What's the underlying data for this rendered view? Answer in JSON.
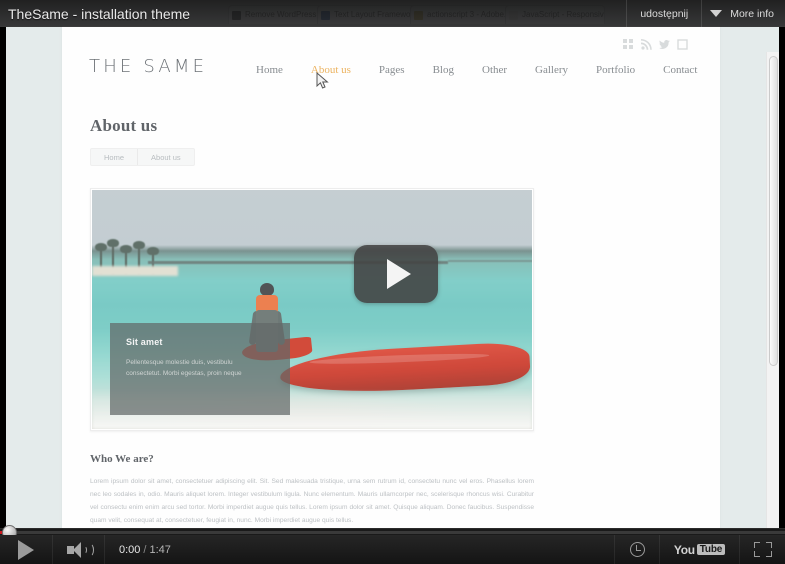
{
  "video_player": {
    "title": "TheSame - installation theme",
    "share_label": "udostępnij",
    "more_info_label": "More info",
    "current_time": "0:00",
    "time_separator": "/",
    "total_time": "1:47",
    "logo_word": "You",
    "logo_box": "Tube",
    "progress_percent": 0,
    "accent_color": "#cc181e"
  },
  "browser": {
    "tabs": [
      {
        "label": "Remove WordPress De...",
        "favicon_color": "#3b4046"
      },
      {
        "label": "Text Layout Framework...",
        "favicon_color": "#2f5fa8"
      },
      {
        "label": "actionscript 3 - Adobe...",
        "favicon_color": "#b8a24a"
      },
      {
        "label": "JavaScript - Responsiv...",
        "favicon_color": "#d6d6d6"
      }
    ]
  },
  "site": {
    "brand": "THE SAME",
    "nav": [
      {
        "label": "Home",
        "active": false
      },
      {
        "label": "About us",
        "active": true
      },
      {
        "label": "Pages",
        "active": false
      },
      {
        "label": "Blog",
        "active": false
      },
      {
        "label": "Other",
        "active": false
      },
      {
        "label": "Gallery",
        "active": false
      },
      {
        "label": "Portfolio",
        "active": false
      },
      {
        "label": "Contact",
        "active": false
      }
    ],
    "social_icons": [
      "grid-icon",
      "rss-icon",
      "twitter-icon",
      "square-icon"
    ],
    "accent_color": "#e8a33d"
  },
  "page": {
    "title": "About us",
    "breadcrumb": [
      {
        "label": "Home"
      },
      {
        "label": "About us"
      }
    ],
    "media": {
      "caption_title": "Sit amet",
      "caption_line1": "Pellentesque molestie duis, vestibulu",
      "caption_line2": "consectetut. Morbi egestas, proin neque",
      "play_button": "play-icon"
    },
    "section": {
      "heading": "Who We are?",
      "body": "Lorem ipsum dolor sit amet, consectetuer adipiscing elit. Sit. Sed malesuada tristique, urna sem rutrum id, consectetu nunc vel eros. Phasellus lorem nec leo sodales in, odio. Mauris aliquet lorem. Integer vestibulum ligula. Nunc elementum. Mauris ullamcorper nec, scelerisque rhoncus wisi. Curabitur vel consectu enim enim arcu sed tortor. Morbi imperdiet augue quis tellus. Lorem ipsum dolor sit amet. Quisque aliquam. Donec faucibus. Suspendisse quam velit, consequat at, consectetuer, feugiat in, nunc. Morbi imperdiet augue quis tellus."
    }
  }
}
